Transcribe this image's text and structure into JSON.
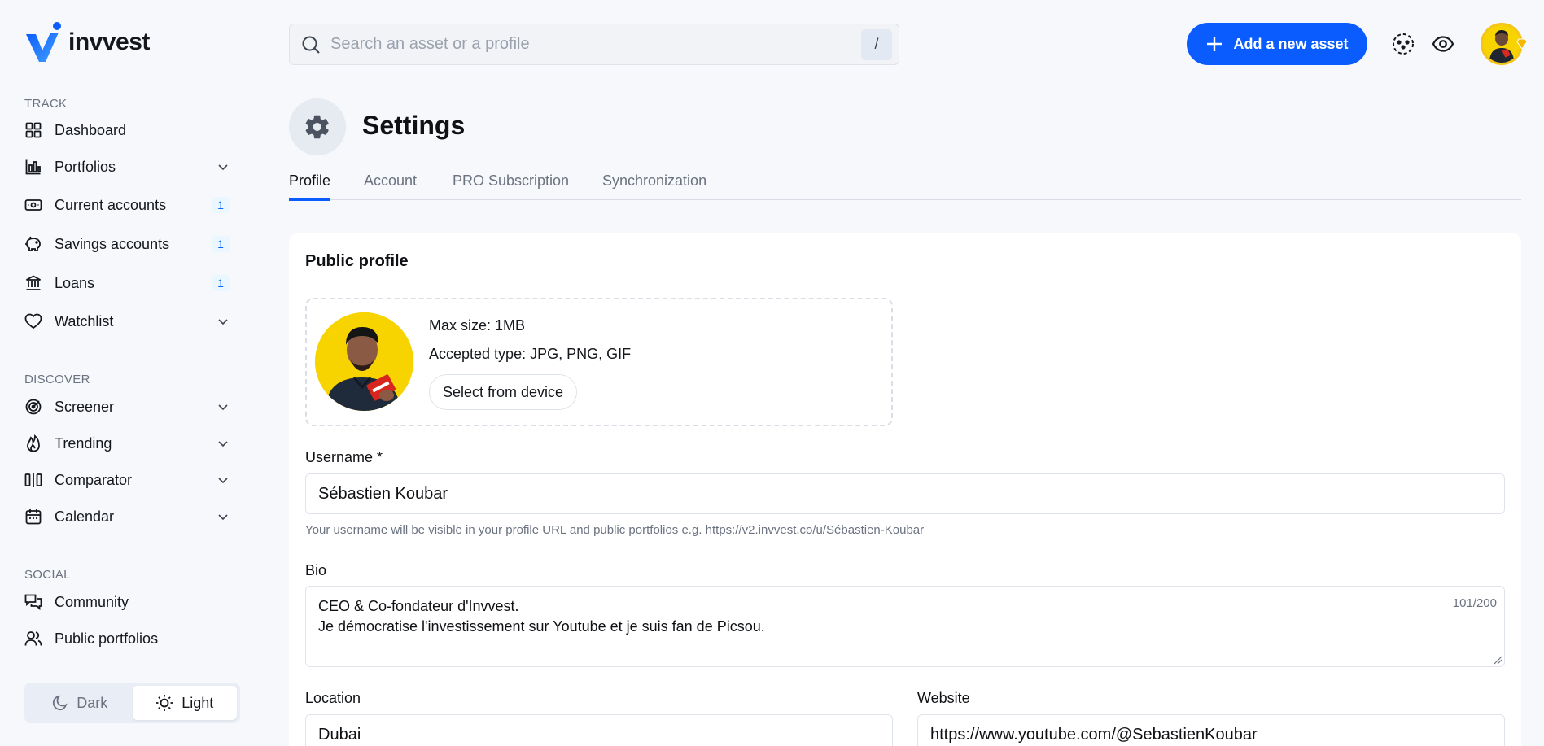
{
  "brand": {
    "name": "invvest"
  },
  "sidebar": {
    "sections": {
      "track": "TRACK",
      "discover": "DISCOVER",
      "social": "SOCIAL"
    },
    "items": {
      "dashboard": {
        "label": "Dashboard",
        "icon": "grid-icon"
      },
      "portfolios": {
        "label": "Portfolios",
        "icon": "bar-chart-icon"
      },
      "current_accounts": {
        "label": "Current accounts",
        "icon": "wallet-icon",
        "badge": "1"
      },
      "savings_accounts": {
        "label": "Savings accounts",
        "icon": "piggy-bank-icon",
        "badge": "1"
      },
      "loans": {
        "label": "Loans",
        "icon": "bank-icon",
        "badge": "1"
      },
      "watchlist": {
        "label": "Watchlist",
        "icon": "heart-icon"
      },
      "screener": {
        "label": "Screener",
        "icon": "radar-icon"
      },
      "trending": {
        "label": "Trending",
        "icon": "flame-icon"
      },
      "comparator": {
        "label": "Comparator",
        "icon": "compare-icon"
      },
      "calendar": {
        "label": "Calendar",
        "icon": "calendar-icon"
      },
      "community": {
        "label": "Community",
        "icon": "chat-icon"
      },
      "public_portfolios": {
        "label": "Public portfolios",
        "icon": "users-icon"
      }
    },
    "theme": {
      "dark": "Dark",
      "light": "Light",
      "selected": "Light"
    }
  },
  "topbar": {
    "search_placeholder": "Search an asset or a profile",
    "search_shortcut": "/",
    "add_button": "Add a new asset"
  },
  "page": {
    "title": "Settings",
    "tabs": [
      "Profile",
      "Account",
      "PRO Subscription",
      "Synchronization"
    ],
    "active_tab": "Profile"
  },
  "profile": {
    "section_title": "Public profile",
    "upload": {
      "max_size": "Max size: 1MB",
      "accepted": "Accepted type: JPG, PNG, GIF",
      "button": "Select from device"
    },
    "username": {
      "label": "Username *",
      "value": "Sébastien Koubar",
      "help": "Your username will be visible in your profile URL and public portfolios e.g. https://v2.invvest.co/u/Sébastien-Koubar"
    },
    "bio": {
      "label": "Bio",
      "line1": "CEO & Co-fondateur d'Invvest.",
      "line2": "Je démocratise l'investissement sur Youtube et je suis fan de Picsou.",
      "counter": "101/200"
    },
    "location": {
      "label": "Location",
      "value": "Dubai"
    },
    "website": {
      "label": "Website",
      "value": "https://www.youtube.com/@SebastienKoubar"
    }
  },
  "colors": {
    "accent": "#0a5cff",
    "background": "#f6f8fb",
    "badge_bg": "#eaf7ff",
    "avatar_ring": "#f5c518"
  }
}
